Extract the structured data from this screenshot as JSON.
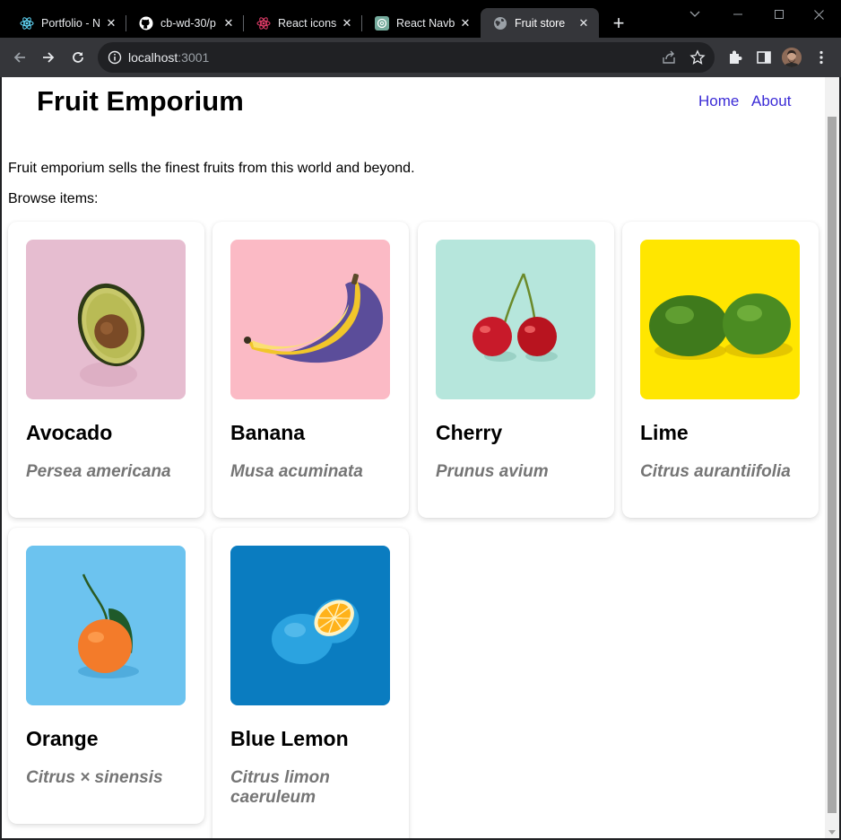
{
  "browser": {
    "tabs": [
      {
        "title": "Portfolio - N",
        "icon": "react-icon"
      },
      {
        "title": "cb-wd-30/p",
        "icon": "github-icon"
      },
      {
        "title": "React icons",
        "icon": "react-icon"
      },
      {
        "title": "React Navb",
        "icon": "openai-icon"
      },
      {
        "title": "Fruit store",
        "icon": "globe-icon"
      }
    ],
    "url_host": "localhost",
    "url_port": ":3001"
  },
  "site": {
    "title": "Fruit Emporium",
    "nav": {
      "home": "Home",
      "about": "About"
    },
    "intro": "Fruit emporium sells the finest fruits from this world and beyond.",
    "browse": "Browse items:"
  },
  "fruits": [
    {
      "name": "Avocado",
      "scientific": "Persea americana",
      "bg": "#e6bdd0"
    },
    {
      "name": "Banana",
      "scientific": "Musa acuminata",
      "bg": "#fbbac5"
    },
    {
      "name": "Cherry",
      "scientific": "Prunus avium",
      "bg": "#b6e6dc"
    },
    {
      "name": "Lime",
      "scientific": "Citrus aurantiifolia",
      "bg": "#ffe600"
    },
    {
      "name": "Orange",
      "scientific": "Citrus × sinensis",
      "bg": "#6cc3ef"
    },
    {
      "name": "Blue Lemon",
      "scientific": "Citrus limon caeruleum",
      "bg": "#0a7cc0"
    }
  ],
  "colors": {
    "link": "#3b2bd6",
    "subtitle": "#757575"
  }
}
